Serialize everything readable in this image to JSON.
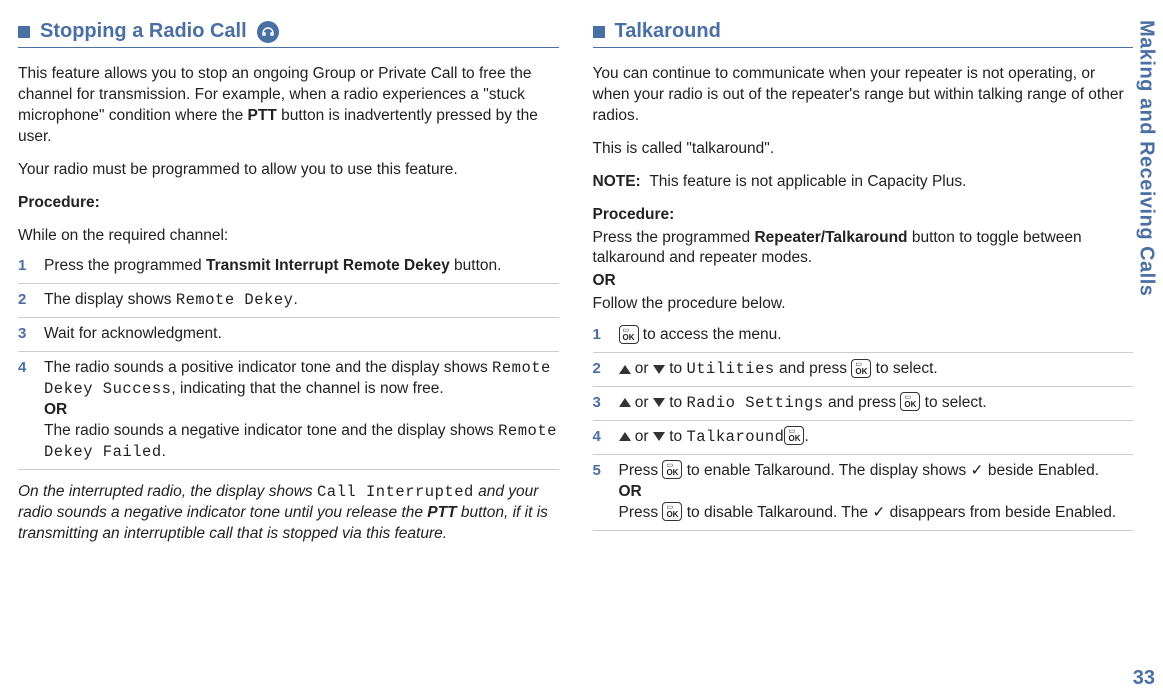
{
  "sidebar": "Making and Receiving Calls",
  "pageNumber": "33",
  "left": {
    "title": "Stopping a Radio Call",
    "iconName": "headset-icon",
    "intro1a": "This feature allows you to stop an ongoing Group or Private Call to free the channel for transmission. For example, when a radio experiences a \"stuck microphone\" condition where the ",
    "intro1b": "PTT",
    "intro1c": " button is inadvertently pressed by the user.",
    "intro2": "Your radio must be programmed to allow you to use this feature.",
    "procLabel": "Procedure:",
    "procCond": "While on the required channel:",
    "steps": [
      {
        "n": "1",
        "pre": "Press the programmed ",
        "bold": "Transmit Interrupt Remote Dekey",
        "post": " button."
      },
      {
        "n": "2",
        "pre": "The display shows ",
        "lcd": "Remote Dekey",
        "post": "."
      },
      {
        "n": "3",
        "pre": "Wait for acknowledgment."
      },
      {
        "n": "4",
        "pre": "The radio sounds a positive indicator tone and the display shows ",
        "lcd": "Remote Dekey Success",
        "mid": ", indicating that the channel is now free.",
        "or": "OR",
        "pre2": "The radio sounds a negative indicator tone and the display shows ",
        "lcd2": "Remote Dekey Failed",
        "post2": "."
      }
    ],
    "footA": "On the interrupted radio, the display shows ",
    "footLcd": "Call Interrupted",
    "footB": " and your radio sounds a negative indicator tone until you release the ",
    "footBold": "PTT",
    "footC": " button, if it is transmitting an interruptible call that is stopped via this feature."
  },
  "right": {
    "title": "Talkaround",
    "intro1": "You can continue to communicate when your repeater is not operating, or when your radio is out of the repeater's range but within talking range of other radios.",
    "intro2": "This is called \"talkaround\".",
    "noteLabel": "NOTE:",
    "noteText": "This feature is not applicable in Capacity Plus.",
    "procLabel": "Procedure:",
    "procLine1a": "Press the programmed ",
    "procLine1b": "Repeater/Talkaround",
    "procLine1c": " button to toggle between talkaround and repeater modes.",
    "or": "OR",
    "procLine2": "Follow the procedure below.",
    "steps": [
      {
        "n": "1",
        "post": " to access the menu."
      },
      {
        "n": "2",
        "mid": " to ",
        "lcd": "Utilities",
        "mid2": " and press ",
        "post": " to select."
      },
      {
        "n": "3",
        "mid": " to ",
        "lcd": "Radio Settings",
        "mid2": " and press ",
        "post": " to select."
      },
      {
        "n": "4",
        "mid": " to ",
        "lcd": "Talkaround",
        "post": "."
      },
      {
        "n": "5",
        "pre": "Press ",
        "mid": " to enable Talkaround. The display shows ",
        "check": "✓",
        "mid2": " beside Enabled.",
        "or": "OR",
        "pre2": "Press ",
        "mid3": " to disable Talkaround. The ",
        "check2": "✓",
        "post2": " disappears from beside Enabled."
      }
    ]
  }
}
